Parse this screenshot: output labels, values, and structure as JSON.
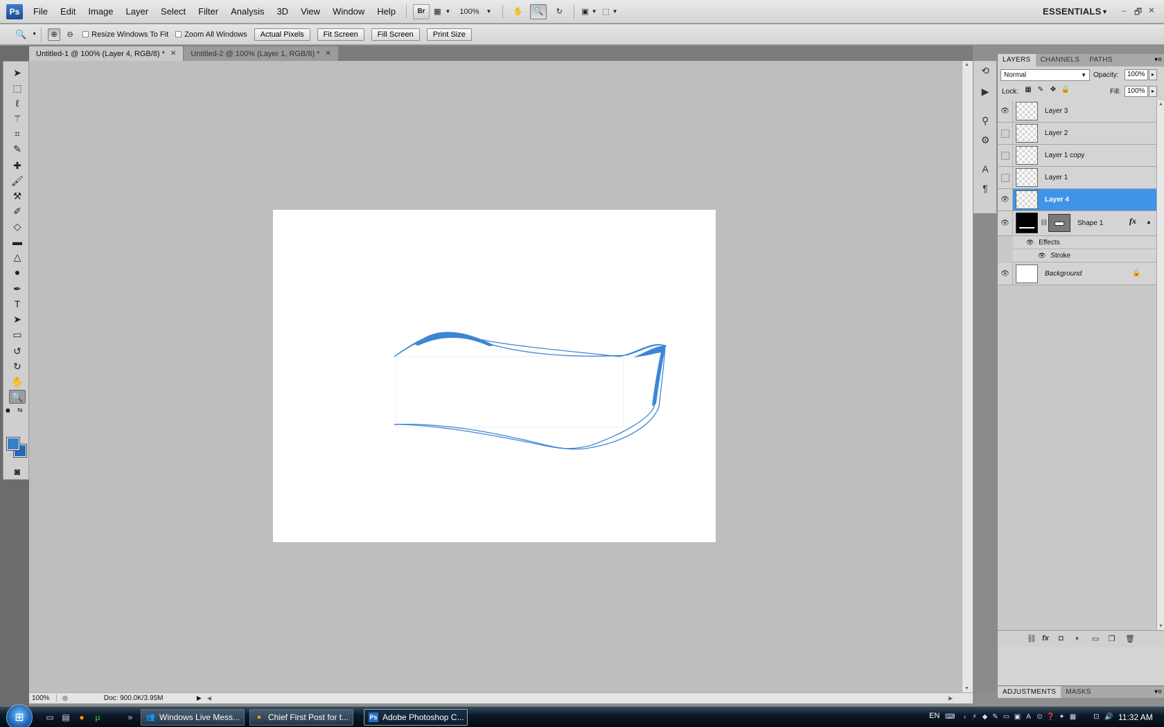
{
  "app": {
    "logo": "Ps",
    "menu": [
      "File",
      "Edit",
      "Image",
      "Layer",
      "Select",
      "Filter",
      "Analysis",
      "3D",
      "View",
      "Window",
      "Help"
    ],
    "bridge_label": "Br",
    "zoom_dropdown": "100%",
    "workspace": "ESSENTIALS",
    "window_controls": [
      "–",
      "🗗",
      "✕"
    ]
  },
  "options_bar": {
    "resize_windows": "Resize Windows To Fit",
    "zoom_all": "Zoom All Windows",
    "actual_pixels": "Actual Pixels",
    "fit_screen": "Fit Screen",
    "fill_screen": "Fill Screen",
    "print_size": "Print Size"
  },
  "tabs": [
    {
      "label": "Untitled-1 @ 100% (Layer 4, RGB/8) *",
      "active": true
    },
    {
      "label": "Untitled-2 @ 100% (Layer 1, RGB/8) *",
      "active": false
    }
  ],
  "status": {
    "zoom": "100%",
    "doc": "Doc: 900.0K/3.95M"
  },
  "colors": {
    "foreground": "#3a7ec8",
    "background": "#2769b8",
    "stroke": "#3d86d6",
    "selected_layer": "#3e94e8"
  },
  "layers_panel": {
    "tabs": [
      "LAYERS",
      "CHANNELS",
      "PATHS"
    ],
    "blend_mode": "Normal",
    "opacity_label": "Opacity:",
    "opacity": "100%",
    "lock_label": "Lock:",
    "fill_label": "Fill:",
    "fill": "100%",
    "layers": [
      {
        "name": "Layer 3",
        "visible": true
      },
      {
        "name": "Layer 2",
        "visible": false
      },
      {
        "name": "Layer 1 copy",
        "visible": false
      },
      {
        "name": "Layer 1",
        "visible": false
      },
      {
        "name": "Layer 4",
        "visible": true,
        "selected": true
      }
    ],
    "shape_layer": {
      "name": "Shape 1",
      "fx": "fx",
      "effects_label": "Effects",
      "stroke_label": "Stroke"
    },
    "background_layer": {
      "name": "Background",
      "locked": true
    },
    "adjust_tabs": [
      "ADJUSTMENTS",
      "MASKS"
    ]
  },
  "taskbar": {
    "buttons": [
      {
        "label": "Windows Live Mess...",
        "icon": "messenger-icon"
      },
      {
        "label": "Chief First Post for t...",
        "icon": "firefox-icon"
      },
      {
        "label": "Adobe Photoshop C...",
        "icon": "photoshop-icon",
        "active": true
      }
    ],
    "language": "EN",
    "time": "11:32 AM"
  }
}
